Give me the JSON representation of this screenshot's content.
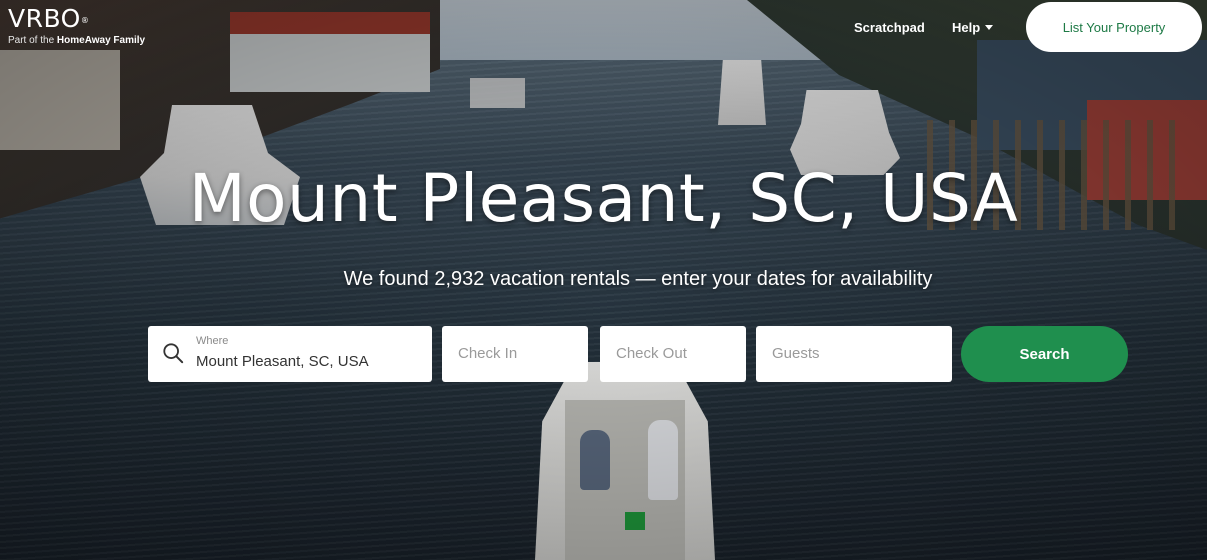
{
  "brand": {
    "logo": "VRBO",
    "registered": "®",
    "tagline_prefix": "Part of the",
    "tagline_brand": "HomeAway Family"
  },
  "nav": {
    "scratchpad": "Scratchpad",
    "help": "Help",
    "list_property": "List Your Property"
  },
  "hero": {
    "title": "Mount Pleasant, SC, USA",
    "subtitle": "We found 2,932 vacation rentals — enter your dates for availability"
  },
  "search": {
    "where_label": "Where",
    "where_value": "Mount Pleasant, SC, USA",
    "checkin_placeholder": "Check In",
    "checkout_placeholder": "Check Out",
    "guests_placeholder": "Guests",
    "button": "Search"
  },
  "colors": {
    "accent": "#1f8f4e",
    "list_button_text": "#1e7a46"
  },
  "icons": {
    "search": "search-icon",
    "dropdown": "chevron-down-icon"
  }
}
